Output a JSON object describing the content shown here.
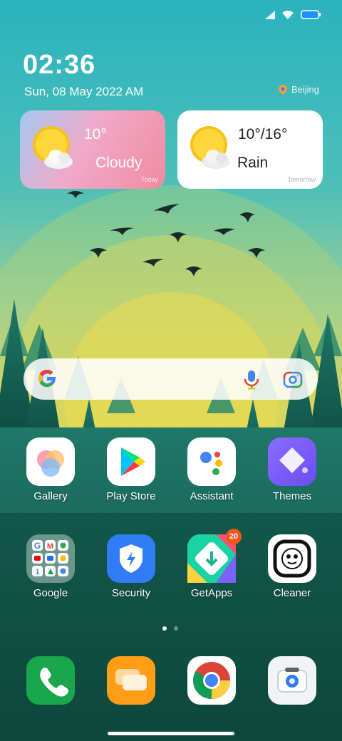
{
  "status": {
    "icons": [
      "signal-icon",
      "wifi-icon",
      "battery-icon"
    ]
  },
  "clock": {
    "time": "02:36",
    "date": "Sun, 08 May 2022 AM",
    "city": "Beijing"
  },
  "weather": {
    "today": {
      "temp": "10°",
      "condition": "Cloudy",
      "label": "Today"
    },
    "tomorrow": {
      "temp": "10°/16°",
      "condition": "Rain",
      "label": "Tomorrow"
    }
  },
  "search": {
    "icons": [
      "google-g-icon",
      "microphone-icon",
      "google-lens-icon"
    ]
  },
  "apps": [
    {
      "label": "Gallery"
    },
    {
      "label": "Play Store"
    },
    {
      "label": "Assistant"
    },
    {
      "label": "Themes"
    },
    {
      "label": "Google"
    },
    {
      "label": "Security"
    },
    {
      "label": "GetApps",
      "badge": "20"
    },
    {
      "label": "Cleaner"
    }
  ],
  "dock": [
    "phone-icon",
    "messages-icon",
    "chrome-icon",
    "camera-icon"
  ],
  "page_indicator": {
    "current": 1,
    "total": 2
  },
  "colors": {
    "accent_badge": "#f2561d",
    "sky_top": "#2ab3bf",
    "sun": "#e8d653",
    "forest": "#1f6b5c"
  }
}
